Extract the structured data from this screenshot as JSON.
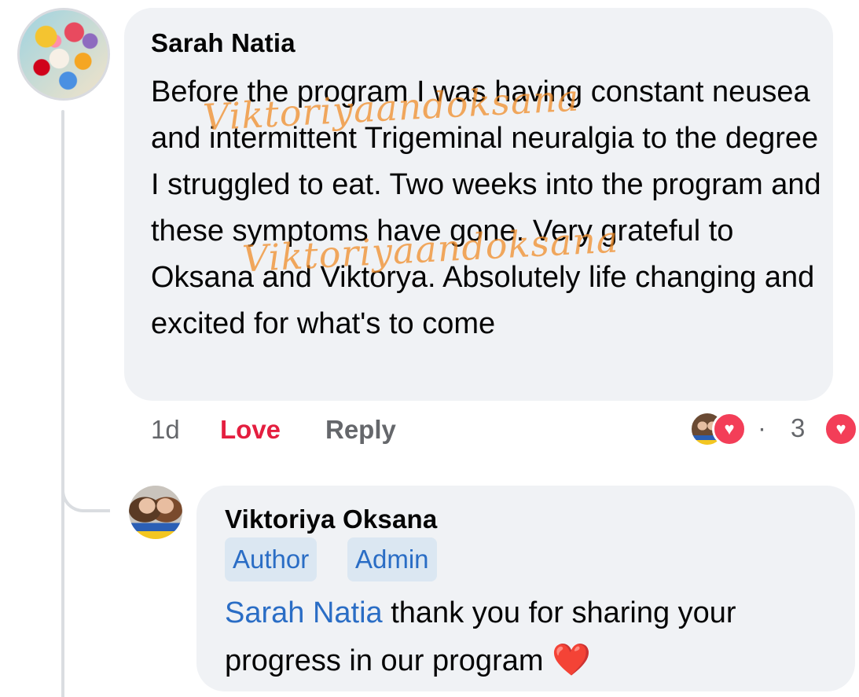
{
  "comment": {
    "author": "Sarah Natia",
    "text": "Before the program I was having constant neusea and intermittent Trigeminal neuralgia to the degree I struggled to eat. Two weeks into the program and these symptoms have gone. Very grateful to Oksana and Viktorya. Absolutely life changing and excited for what's to come",
    "watermark": "Viktoriyaandoksana",
    "time": "1d",
    "love_label": "Love",
    "reply_label": "Reply",
    "reaction_dot": "·",
    "reaction_count": "3",
    "reaction_icon": "heart-icon",
    "reaction_color": "#f33e58"
  },
  "reply": {
    "author": "Viktoriya Oksana",
    "badges": [
      "Author",
      "Admin"
    ],
    "mention": "Sarah Natia",
    "text": " thank you for sharing your progress in our program ",
    "emoji": "❤️"
  },
  "colors": {
    "bubble": "#f0f2f5",
    "link_blue": "#2a6dc5",
    "love_red": "#e41e3f",
    "meta_gray": "#65676b"
  }
}
